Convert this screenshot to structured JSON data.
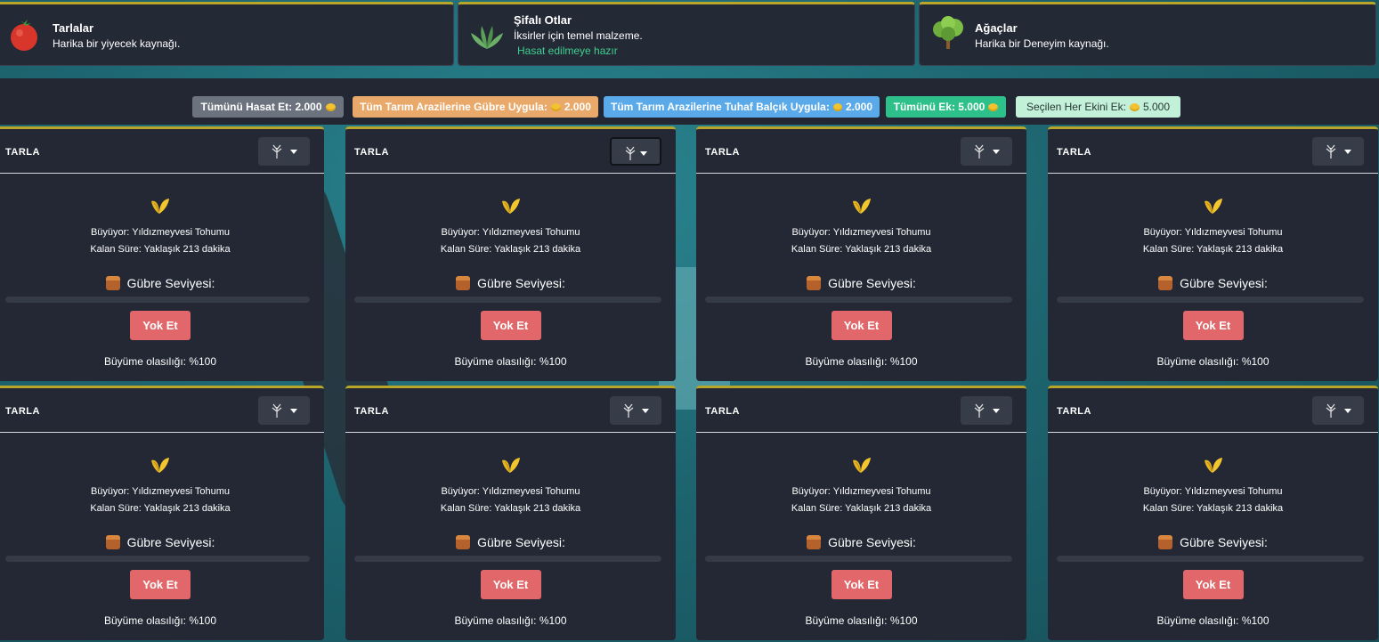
{
  "categories": [
    {
      "title": "Tarlalar",
      "desc": "Harika bir yiyecek kaynağı.",
      "status": "",
      "icon": "tomato-icon"
    },
    {
      "title": "Şifalı Otlar",
      "desc": "İksirler için temel malzeme.",
      "status": "Hasat edilmeye hazır",
      "icon": "herb-icon"
    },
    {
      "title": "Ağaçlar",
      "desc": "Harika bir Deneyim kaynağı.",
      "status": "",
      "icon": "tree-icon"
    }
  ],
  "actions": [
    {
      "label": "Tümünü Hasat Et: 2.000",
      "color": "#6c737e"
    },
    {
      "label": "Tüm Tarım Arazilerine Gübre Uygula:",
      "price": "2.000",
      "color": "#e8a96a"
    },
    {
      "label": "Tüm Tarım Arazilerine Tuhaf Balçık Uygula:",
      "price": "2.000",
      "color": "#5aa9e8"
    },
    {
      "label": "Tümünü Ek: 5.000",
      "color": "#2ec08a"
    },
    {
      "label": "Seçilen Her Ekini Ek:",
      "price": "5.000",
      "color": "#c2f0d8"
    }
  ],
  "plots": [
    {
      "title": "TARLA",
      "growing": "Büyüyor: Yıldızmeyvesi Tohumu",
      "remaining": "Kalan Süre: Yaklaşık 213 dakika",
      "fert_label": "Gübre Seviyesi:",
      "fert_level": 0,
      "destroy": "Yok Et",
      "chance": "Büyüme olasılığı: %100"
    },
    {
      "title": "TARLA",
      "growing": "Büyüyor: Yıldızmeyvesi Tohumu",
      "remaining": "Kalan Süre: Yaklaşık 213 dakika",
      "fert_label": "Gübre Seviyesi:",
      "fert_level": 0,
      "destroy": "Yok Et",
      "chance": "Büyüme olasılığı: %100"
    },
    {
      "title": "TARLA",
      "growing": "Büyüyor: Yıldızmeyvesi Tohumu",
      "remaining": "Kalan Süre: Yaklaşık 213 dakika",
      "fert_label": "Gübre Seviyesi:",
      "fert_level": 0,
      "destroy": "Yok Et",
      "chance": "Büyüme olasılığı: %100"
    },
    {
      "title": "TARLA",
      "growing": "Büyüyor: Yıldızmeyvesi Tohumu",
      "remaining": "Kalan Süre: Yaklaşık 213 dakika",
      "fert_label": "Gübre Seviyesi:",
      "fert_level": 0,
      "destroy": "Yok Et",
      "chance": "Büyüme olasılığı: %100"
    },
    {
      "title": "TARLA",
      "growing": "Büyüyor: Yıldızmeyvesi Tohumu",
      "remaining": "Kalan Süre: Yaklaşık 213 dakika",
      "fert_label": "Gübre Seviyesi:",
      "fert_level": 0,
      "destroy": "Yok Et",
      "chance": "Büyüme olasılığı: %100"
    },
    {
      "title": "TARLA",
      "growing": "Büyüyor: Yıldızmeyvesi Tohumu",
      "remaining": "Kalan Süre: Yaklaşık 213 dakika",
      "fert_label": "Gübre Seviyesi:",
      "fert_level": 0,
      "destroy": "Yok Et",
      "chance": "Büyüme olasılığı: %100"
    },
    {
      "title": "TARLA",
      "growing": "Büyüyor: Yıldızmeyvesi Tohumu",
      "remaining": "Kalan Süre: Yaklaşık 213 dakika",
      "fert_label": "Gübre Seviyesi:",
      "fert_level": 0,
      "destroy": "Yok Et",
      "chance": "Büyüme olasılığı: %100"
    },
    {
      "title": "TARLA",
      "growing": "Büyüyor: Yıldızmeyvesi Tohumu",
      "remaining": "Kalan Süre: Yaklaşık 213 dakika",
      "fert_label": "Gübre Seviyesi:",
      "fert_level": 0,
      "destroy": "Yok Et",
      "chance": "Büyüme olasılığı: %100"
    }
  ]
}
